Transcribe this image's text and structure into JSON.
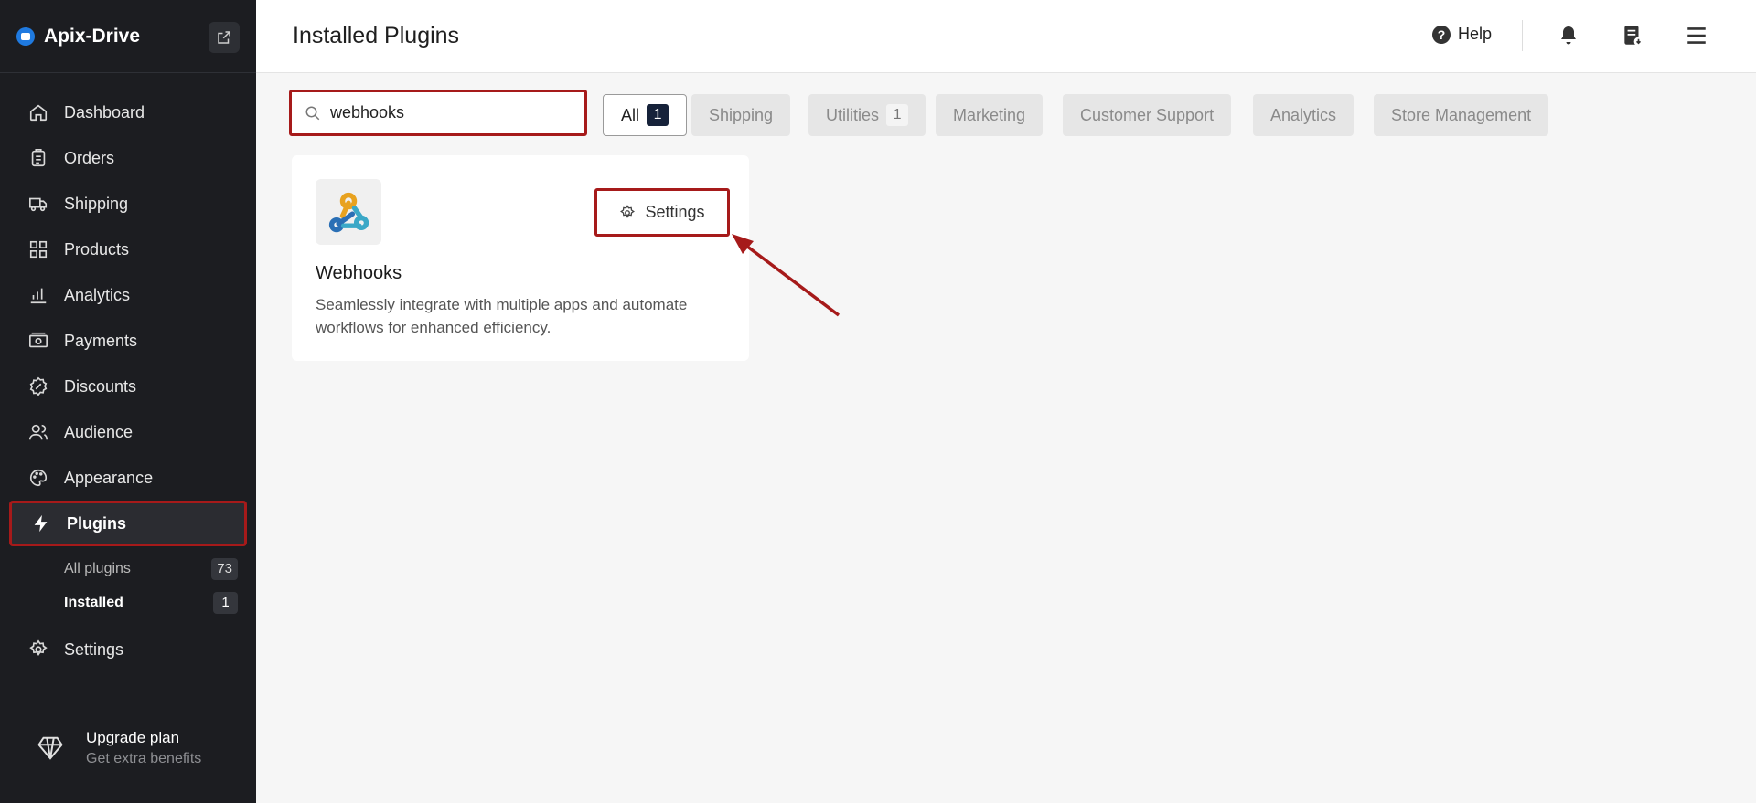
{
  "app": {
    "name": "Apix-Drive"
  },
  "sidebar": {
    "items": [
      {
        "label": "Dashboard",
        "icon": "home-icon"
      },
      {
        "label": "Orders",
        "icon": "clipboard-icon"
      },
      {
        "label": "Shipping",
        "icon": "truck-icon"
      },
      {
        "label": "Products",
        "icon": "grid-icon"
      },
      {
        "label": "Analytics",
        "icon": "bar-chart-icon"
      },
      {
        "label": "Payments",
        "icon": "payments-icon"
      },
      {
        "label": "Discounts",
        "icon": "discount-icon"
      },
      {
        "label": "Audience",
        "icon": "users-icon"
      },
      {
        "label": "Appearance",
        "icon": "palette-icon"
      },
      {
        "label": "Plugins",
        "icon": "lightning-icon",
        "active": true
      },
      {
        "label": "Settings",
        "icon": "gear-icon"
      }
    ],
    "plugins_sub": [
      {
        "label": "All plugins",
        "count": "73"
      },
      {
        "label": "Installed",
        "count": "1",
        "current": true
      }
    ],
    "upgrade": {
      "title": "Upgrade plan",
      "subtitle": "Get extra benefits"
    }
  },
  "header": {
    "title": "Installed Plugins",
    "help_label": "Help"
  },
  "filters": {
    "search_value": "webhooks",
    "tabs": [
      {
        "label": "All",
        "count": "1",
        "active": true
      },
      {
        "label": "Shipping"
      },
      {
        "label": "Utilities",
        "count": "1"
      },
      {
        "label": "Marketing"
      },
      {
        "label": "Customer Support"
      },
      {
        "label": "Analytics"
      },
      {
        "label": "Store Management"
      }
    ]
  },
  "plugin_card": {
    "title": "Webhooks",
    "description": "Seamlessly integrate with multiple apps and automate workflows for enhanced efficiency.",
    "settings_label": "Settings"
  },
  "colors": {
    "sidebar_bg": "#1c1d21",
    "highlight": "#a61a1a",
    "badge_dark": "#16223a",
    "brand": "#1f7ae0"
  }
}
